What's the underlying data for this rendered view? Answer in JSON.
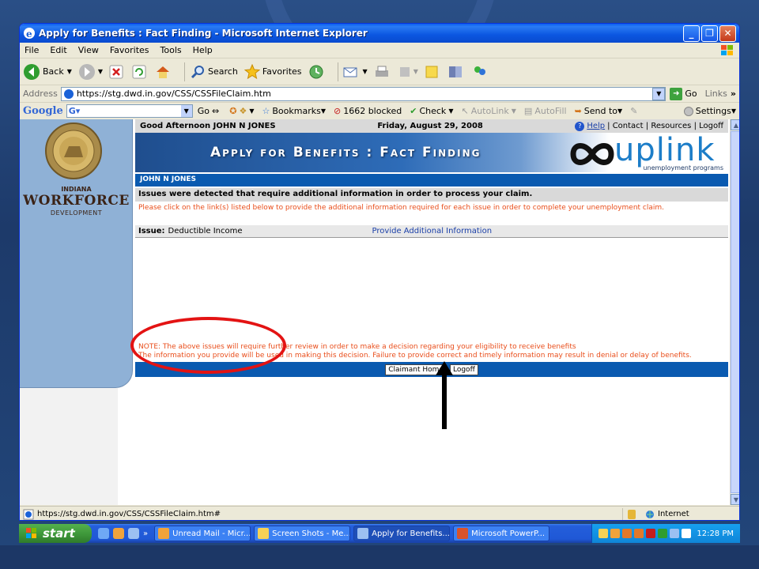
{
  "window": {
    "title": "Apply for Benefits : Fact Finding - Microsoft Internet Explorer",
    "minimize_label": "_",
    "maximize_label": "❐",
    "close_label": "✕"
  },
  "menu": [
    "File",
    "Edit",
    "View",
    "Favorites",
    "Tools",
    "Help"
  ],
  "toolbar": {
    "back_label": "Back",
    "search_label": "Search",
    "favorites_label": "Favorites"
  },
  "address": {
    "label": "Address",
    "url": "https://stg.dwd.in.gov/CSS/CSSFileClaim.htm",
    "go_label": "Go",
    "links_label": "Links"
  },
  "google_bar": {
    "logo": "Google",
    "go_label": "Go",
    "bookmarks_label": "Bookmarks",
    "blocked_label": "1662 blocked",
    "check_label": "Check",
    "autolink_label": "AutoLink",
    "autofill_label": "AutoFill",
    "sendto_label": "Send to",
    "settings_label": "Settings"
  },
  "sidebar": {
    "state_label": "INDIANA",
    "org_main": "WORKFORCE",
    "org_sub": "DEVELOPMENT"
  },
  "page": {
    "greeting": "Good Afternoon JOHN N JONES",
    "date": "Friday, August 29, 2008",
    "help_label": "Help",
    "contact_label": "| Contact | Resources | Logoff",
    "banner_title": "Apply for Benefits : Fact Finding",
    "brand_word": "uplink",
    "brand_sub": "unemployment programs",
    "claimant_name": "JOHN N JONES",
    "issues_header": "Issues were detected that require additional information in order to process your claim.",
    "instructions": "Please click on the link(s) listed below to provide the additional information required for each issue in order to complete your unemployment claim.",
    "issue": {
      "label": "Issue:",
      "value": "Deductible Income",
      "link": "Provide Additional Information"
    },
    "note_line1": "NOTE: The above issues will require further review in order to make a decision regarding your eligibility to receive benefits",
    "note_line2": "The information you provide will be used in making this decision. Failure to provide correct and timely information may result in denial or delay of benefits.",
    "claimant_home_label": "Claimant Home",
    "logoff_label": "Logoff"
  },
  "status": {
    "url": "https://stg.dwd.in.gov/CSS/CSSFileClaim.htm#",
    "zone": "Internet"
  },
  "taskbar": {
    "start_label": "start",
    "tasks": [
      "Unread Mail - Micr...",
      "Screen Shots - Me...",
      "Apply for Benefits...",
      "Microsoft PowerP..."
    ],
    "clock": "12:28 PM"
  },
  "colors": {
    "accent_blue": "#0a5ab0",
    "warning_orange": "#e94e1b",
    "annotation_red": "#e31313"
  }
}
